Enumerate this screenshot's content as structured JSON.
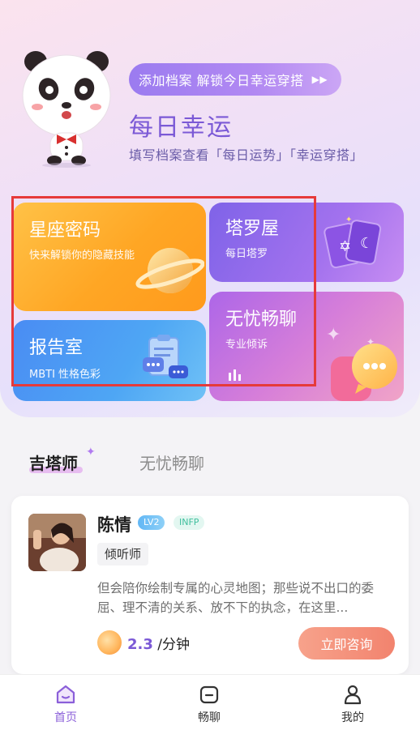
{
  "hero": {
    "promo_text": "添加档案 解锁今日幸运穿搭",
    "title": "每日幸运",
    "subtitle": "填写档案查看「每日运势」「幸运穿搭」"
  },
  "cards": {
    "star": {
      "title": "星座密码",
      "subtitle": "快来解锁你的隐藏技能"
    },
    "tarot": {
      "title": "塔罗屋",
      "subtitle": "每日塔罗"
    },
    "report": {
      "title": "报告室",
      "subtitle": "MBTI 性格色彩"
    },
    "chat": {
      "title": "无忧畅聊",
      "subtitle": "专业倾诉"
    }
  },
  "tabs": {
    "active": "吉塔师",
    "inactive": "无忧畅聊"
  },
  "consultant": {
    "name": "陈情",
    "level": "LV2",
    "mbti": "INFP",
    "role": "倾听师",
    "description": "但会陪你绘制专属的心灵地图；那些说不出口的委屈、理不清的关系、放不下的执念，在这里...",
    "price_value": "2.3",
    "price_unit": "/分钟",
    "button": "立即咨询"
  },
  "nav": {
    "home": "首页",
    "chat": "畅聊",
    "mine": "我的"
  },
  "colors": {
    "accent": "#7b59d6",
    "highlight_box": "#e63a3a"
  }
}
